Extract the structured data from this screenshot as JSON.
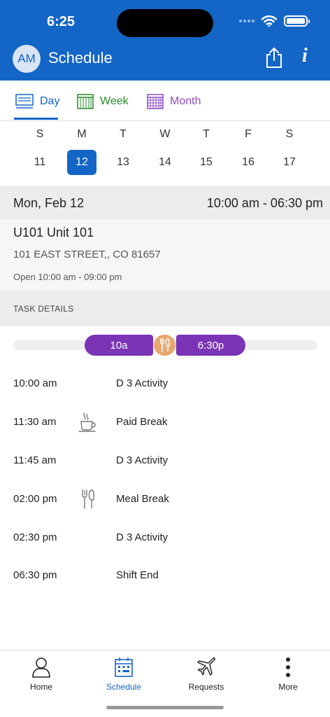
{
  "status": {
    "time": "6:25"
  },
  "header": {
    "avatar": "AM",
    "title": "Schedule"
  },
  "tabs": {
    "day": "Day",
    "week": "Week",
    "month": "Month",
    "selected": "Day"
  },
  "week": {
    "days": [
      "S",
      "M",
      "T",
      "W",
      "T",
      "F",
      "S"
    ],
    "dates": [
      "11",
      "12",
      "13",
      "14",
      "15",
      "16",
      "17"
    ],
    "selected_date": "12"
  },
  "shift": {
    "date": "Mon, Feb 12",
    "time_range": "10:00 am - 06:30 pm"
  },
  "location": {
    "name": "U101  Unit 101",
    "address": "101 EAST  STREET,, CO 81657",
    "hours": "Open 10:00 am - 09:00 pm"
  },
  "task_details_label": "TASK DETAILS",
  "timeline": {
    "start_label": "10a",
    "end_label": "6:30p",
    "break_icon": "fork-knife-icon"
  },
  "tasks": [
    {
      "time": "10:00 am",
      "icon": "",
      "name": "D 3 Activity"
    },
    {
      "time": "11:30 am",
      "icon": "coffee-cup-icon",
      "name": "Paid Break"
    },
    {
      "time": "11:45 am",
      "icon": "",
      "name": "D 3 Activity"
    },
    {
      "time": "02:00 pm",
      "icon": "fork-knife-icon",
      "name": "Meal Break"
    },
    {
      "time": "02:30 pm",
      "icon": "",
      "name": "D 3 Activity"
    },
    {
      "time": "06:30 pm",
      "icon": "",
      "name": "Shift End"
    }
  ],
  "tabbar": {
    "home": "Home",
    "schedule": "Schedule",
    "requests": "Requests",
    "more": "More",
    "active": "Schedule"
  },
  "colors": {
    "primary": "#1466c6",
    "week": "#2a8a2a",
    "month": "#8a4bc0",
    "shift": "#7a34b5",
    "break": "#e8a872"
  }
}
